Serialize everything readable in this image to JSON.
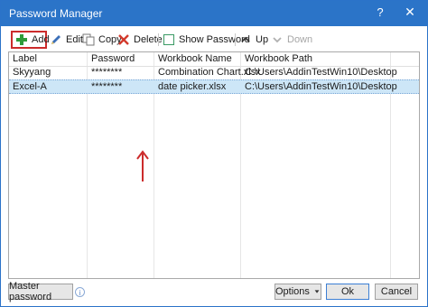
{
  "window": {
    "title": "Password Manager",
    "help_glyph": "?",
    "close_glyph": "✕"
  },
  "toolbar": {
    "add_label": "Add",
    "edit_label": "Edit",
    "copy_label": "Copy",
    "delete_label": "Delete",
    "show_password_label": "Show Password",
    "show_password_checked": false,
    "up_label": "Up",
    "down_label": "Down"
  },
  "table": {
    "columns": [
      "Label",
      "Password",
      "Workbook Name",
      "Workbook Path"
    ],
    "rows": [
      {
        "label": "Skyyang",
        "password": "********",
        "workbook_name": "Combination Chart.xlsx",
        "workbook_path": "C:\\Users\\AddinTestWin10\\Desktop"
      },
      {
        "label": "Excel-A",
        "password": "********",
        "workbook_name": "date picker.xlsx",
        "workbook_path": "C:\\Users\\AddinTestWin10\\Desktop"
      }
    ],
    "selected_row_index": 1
  },
  "footer": {
    "master_password_label": "Master password",
    "info_glyph": "i",
    "options_label": "Options",
    "ok_label": "Ok",
    "cancel_label": "Cancel"
  },
  "colors": {
    "titlebar": "#2b74c8",
    "selection": "#cde6f7",
    "annotation": "#cc2b2b"
  }
}
